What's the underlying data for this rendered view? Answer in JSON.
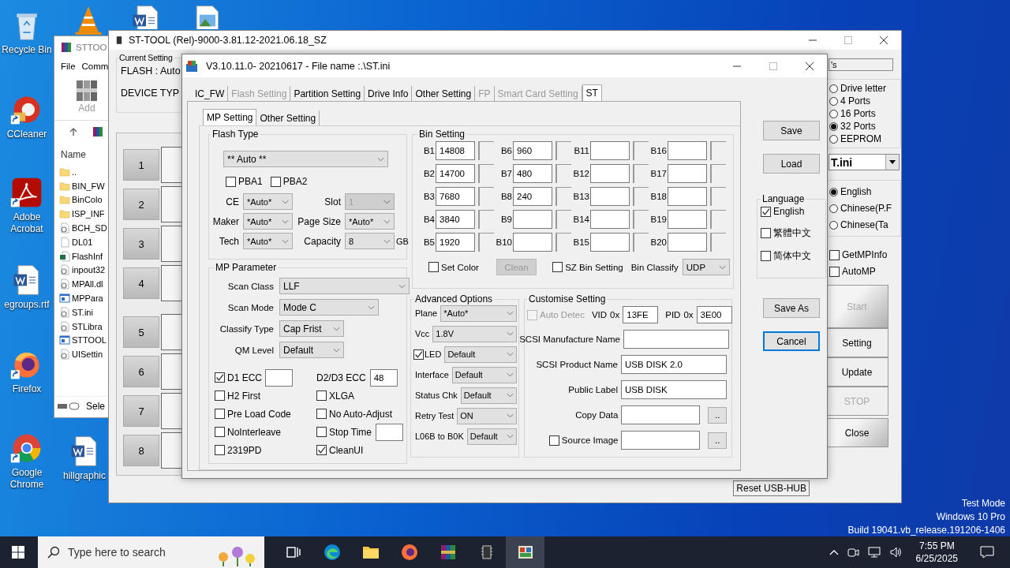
{
  "desktop_icons": [
    {
      "label": "Recycle Bin",
      "kind": "recycle",
      "shortcut": false
    },
    {
      "label": "CCleaner",
      "kind": "ccleaner",
      "shortcut": true
    },
    {
      "label": "Adobe Acrobat",
      "kind": "acrobat",
      "shortcut": true
    },
    {
      "label": "egroups.rtf",
      "kind": "word",
      "shortcut": false
    },
    {
      "label": "Firefox",
      "kind": "firefox",
      "shortcut": true
    },
    {
      "label": "Google Chrome",
      "kind": "chrome",
      "shortcut": true
    },
    {
      "label": "hillgraphic",
      "kind": "word",
      "shortcut": false
    }
  ],
  "desktop_top_icons": [
    {
      "kind": "cone"
    },
    {
      "kind": "word"
    },
    {
      "kind": "image"
    }
  ],
  "explorer": {
    "title": "STTOO",
    "menu": [
      "File",
      "Comm"
    ],
    "toolbar_button": "Add",
    "column": "Name",
    "status": "Sele",
    "files": [
      {
        "name": "..",
        "kind": "folder"
      },
      {
        "name": "BIN_FW",
        "kind": "folder"
      },
      {
        "name": "BinColo",
        "kind": "folder"
      },
      {
        "name": "ISP_INF",
        "kind": "folder"
      },
      {
        "name": "BCH_SD",
        "kind": "dll"
      },
      {
        "name": "DL01",
        "kind": "file"
      },
      {
        "name": "FlashInf",
        "kind": "excel"
      },
      {
        "name": "inpout32",
        "kind": "dll"
      },
      {
        "name": "MPAll.dl",
        "kind": "dll"
      },
      {
        "name": "MPPara",
        "kind": "app"
      },
      {
        "name": "ST.ini",
        "kind": "ini"
      },
      {
        "name": "STLibra",
        "kind": "dll"
      },
      {
        "name": "STTOOL",
        "kind": "app"
      },
      {
        "name": "UISettin",
        "kind": "ini"
      }
    ]
  },
  "main_window": {
    "title": "ST-TOOL (Rel)-9000-3.81.12-2021.06.18_SZ",
    "current_setting": {
      "legend": "Current Setting",
      "flash": "FLASH : Auto",
      "device_type": "DEVICE TYP"
    },
    "ports": [
      "1",
      "2",
      "3",
      "4",
      "5",
      "6",
      "7",
      "8"
    ],
    "name_field": "'s",
    "port_modes": [
      {
        "label": "Drive letter",
        "selected": false
      },
      {
        "label": "4 Ports",
        "selected": false
      },
      {
        "label": "16 Ports",
        "selected": false
      },
      {
        "label": "32 Ports",
        "selected": true
      },
      {
        "label": "EEPROM",
        "selected": false
      }
    ],
    "ini_combo": "T.ini",
    "languages": [
      {
        "label": "English",
        "selected": true
      },
      {
        "label": "Chinese(P.F",
        "selected": false
      },
      {
        "label": "Chinese(Ta",
        "selected": false
      }
    ],
    "options": [
      {
        "label": "GetMPInfo",
        "checked": false
      },
      {
        "label": "AutoMP",
        "checked": false
      }
    ],
    "actions": [
      {
        "label": "Start",
        "disabled": true
      },
      {
        "label": "Setting",
        "disabled": false
      },
      {
        "label": "Update",
        "disabled": false
      },
      {
        "label": "STOP",
        "disabled": true
      },
      {
        "label": "Close",
        "disabled": false
      }
    ],
    "reset_button": "Reset USB-HUB"
  },
  "dialog": {
    "title": "V3.10.11.0- 20210617 - File name :.\\ST.ini",
    "tabs": [
      {
        "label": "IC_FW",
        "selected": false,
        "disabled": false
      },
      {
        "label": "Flash Setting",
        "selected": false,
        "disabled": true
      },
      {
        "label": "Partition Setting",
        "selected": false,
        "disabled": false
      },
      {
        "label": "Drive Info",
        "selected": false,
        "disabled": false
      },
      {
        "label": "Other Setting",
        "selected": false,
        "disabled": false
      },
      {
        "label": "FP",
        "selected": false,
        "disabled": true
      },
      {
        "label": "Smart Card Setting",
        "selected": false,
        "disabled": true
      },
      {
        "label": "ST",
        "selected": true,
        "disabled": false
      }
    ],
    "subtabs": [
      {
        "label": "MP Setting",
        "selected": true
      },
      {
        "label": "Other Setting",
        "selected": false
      }
    ],
    "flash_type": {
      "legend": "Flash Type",
      "value": "** Auto **",
      "pba": [
        {
          "label": "PBA1",
          "checked": false
        },
        {
          "label": "PBA2",
          "checked": false
        }
      ],
      "fields": [
        {
          "label": "CE",
          "value": "*Auto*",
          "disabled": false
        },
        {
          "label": "Slot",
          "value": "1",
          "disabled": true
        },
        {
          "label": "Maker",
          "value": "*Auto*",
          "disabled": false
        },
        {
          "label": "Page Size",
          "value": "*Auto*",
          "disabled": false
        },
        {
          "label": "Tech",
          "value": "*Auto*",
          "disabled": false
        },
        {
          "label": "Capacity",
          "value": "8",
          "disabled": false
        }
      ],
      "unit": "GB"
    },
    "bin_setting": {
      "legend": "Bin Setting",
      "bins": [
        {
          "label": "B1",
          "value": "14808"
        },
        {
          "label": "B2",
          "value": "14700"
        },
        {
          "label": "B3",
          "value": "7680"
        },
        {
          "label": "B4",
          "value": "3840"
        },
        {
          "label": "B5",
          "value": "1920"
        },
        {
          "label": "B6",
          "value": "960"
        },
        {
          "label": "B7",
          "value": "480"
        },
        {
          "label": "B8",
          "value": "240"
        },
        {
          "label": "B9"
        },
        {
          "label": "B10"
        },
        {
          "label": "B11"
        },
        {
          "label": "B12"
        },
        {
          "label": "B13"
        },
        {
          "label": "B14"
        },
        {
          "label": "B15"
        },
        {
          "label": "B16"
        },
        {
          "label": "B17"
        },
        {
          "label": "B18"
        },
        {
          "label": "B19"
        },
        {
          "label": "B20"
        }
      ],
      "set_color": {
        "label": "Set Color",
        "checked": false
      },
      "clean_button": {
        "label": "Clean",
        "disabled": true
      },
      "sz_bin": {
        "label": "SZ Bin Setting",
        "checked": false
      },
      "classify": {
        "label": "Bin Classify",
        "value": "UDP"
      }
    },
    "mp_parameter": {
      "legend": "MP Parameter",
      "selects": [
        {
          "label": "Scan Class",
          "value": "LLF"
        },
        {
          "label": "Scan Mode",
          "value": "Mode C"
        },
        {
          "label": "Classify Type",
          "value": "Cap Frist"
        },
        {
          "label": "QM Level",
          "value": "Default"
        }
      ],
      "checks": [
        {
          "kind": "check-input",
          "label": "D1 ECC",
          "checked": true
        },
        {
          "kind": "input",
          "label": "D2/D3 ECC",
          "value": "48"
        },
        {
          "kind": "check",
          "label": "H2 First",
          "checked": false
        },
        {
          "kind": "check",
          "label": "XLGA",
          "checked": false
        },
        {
          "kind": "check",
          "label": "Pre Load Code",
          "checked": false
        },
        {
          "kind": "check",
          "label": "No Auto-Adjust",
          "checked": false
        },
        {
          "kind": "check",
          "label": "NoInterleave",
          "checked": false
        },
        {
          "kind": "check-input",
          "label": "Stop Time",
          "checked": false
        },
        {
          "kind": "check",
          "label": "2319PD",
          "checked": false
        },
        {
          "kind": "check",
          "label": "CleanUI",
          "checked": true
        }
      ]
    },
    "advanced": {
      "legend": "Advanced Options",
      "rows": [
        {
          "kind": "select",
          "label": "Plane",
          "value": "*Auto*"
        },
        {
          "kind": "select",
          "label": "Vcc",
          "value": "1.8V"
        },
        {
          "kind": "check-select",
          "label": "LED",
          "value": "Default",
          "checked": true
        },
        {
          "kind": "select",
          "label": "Interface",
          "value": "Default"
        },
        {
          "kind": "select",
          "label": "Status Chk",
          "value": "Default"
        },
        {
          "kind": "select",
          "label": "Retry Test",
          "value": "ON"
        },
        {
          "kind": "select",
          "label": "L06B to B0K",
          "value": "Default"
        }
      ]
    },
    "customise": {
      "legend": "Customise Setting",
      "auto_detect": {
        "label": "Auto Detec",
        "checked": false,
        "disabled": true
      },
      "ids": [
        {
          "label": "VID",
          "prefix": "0x",
          "value": "13FE"
        },
        {
          "label": "PID",
          "prefix": "0x",
          "value": "3E00"
        }
      ],
      "fields": [
        {
          "kind": "text",
          "label": "SCSI Manufacture Name"
        },
        {
          "kind": "text",
          "label": "SCSI Product Name",
          "value": "USB DISK 2.0"
        },
        {
          "kind": "text",
          "label": "Public Label",
          "value": "USB DISK"
        },
        {
          "kind": "browse",
          "label": "Copy Data",
          "button": ".."
        },
        {
          "kind": "check-browse",
          "label": "Source Image",
          "checked": false,
          "button": ".."
        }
      ]
    },
    "side_buttons": [
      "Save",
      "Load"
    ],
    "language": {
      "legend": "Language",
      "options": [
        {
          "label": "English",
          "checked": true
        },
        {
          "label": "繁體中文",
          "checked": false
        },
        {
          "label": "简体中文",
          "checked": false
        }
      ]
    },
    "bottom_buttons": [
      {
        "label": "Save As",
        "focused": false
      },
      {
        "label": "Cancel",
        "focused": true
      }
    ]
  },
  "os_notice": [
    "Test Mode",
    "Windows 10 Pro",
    "Build 19041.vb_release.191206-1406"
  ],
  "taskbar": {
    "search_placeholder": "Type here to search",
    "apps": [
      {
        "kind": "task-view",
        "active": false
      },
      {
        "kind": "edge",
        "active": false
      },
      {
        "kind": "explorer",
        "active": false
      },
      {
        "kind": "firefox",
        "active": false
      },
      {
        "kind": "winrar",
        "active": false
      },
      {
        "kind": "chip",
        "active": false
      },
      {
        "kind": "app",
        "active": true
      }
    ],
    "time": "7:55 PM",
    "date": "6/25/2025"
  }
}
